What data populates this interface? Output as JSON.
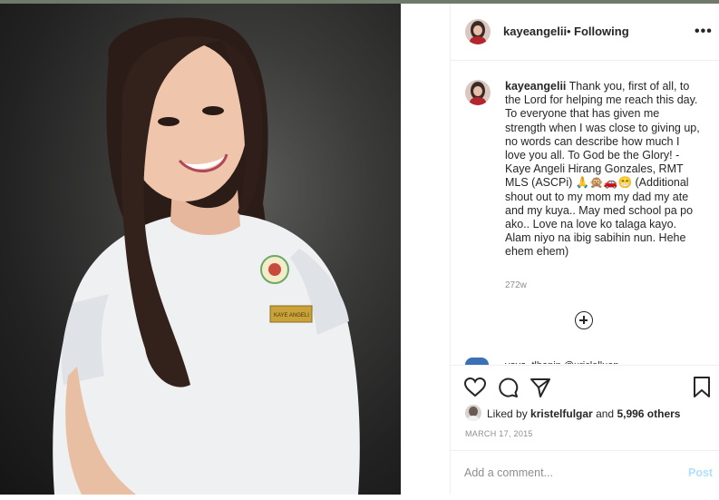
{
  "post": {
    "username": "kayeangelii",
    "separator": "•",
    "follow_status": "Following",
    "more_label": "•••",
    "caption_username": "kayeangelii",
    "caption_text": " Thank you, first of all, to the Lord for helping me reach this day. To everyone that has given me strength when I was close to giving up, no words can describe how much I love you all. To God be the Glory! - Kaye Angeli Hirang Gonzales, RMT MLS (ASCPi) 🙏🙊🚗😁 (Additional shout out to my mom my dad my ate and my kuya.. May med school pa po ako.. Love na love ko talaga kayo. Alam niyo na ibig sabihin nun. Hehe ehem ehem)",
    "caption_time": "272w",
    "next_comment_peek": "yoyo_tlhenin @uriclelluen dano"
  },
  "actions": {
    "liked_by_prefix": "Liked by ",
    "liked_by_user": "kristelfulgar",
    "liked_by_and": " and ",
    "liked_by_others": "5,996 others",
    "date": "MARCH 17, 2015"
  },
  "comment": {
    "placeholder": "Add a comment...",
    "post_label": "Post"
  },
  "colors": {
    "text": "#262626",
    "secondary": "#8e8e8e",
    "post_disabled": "#b2dffc",
    "divider": "#efefef"
  },
  "icons": [
    "heart-icon",
    "comment-icon",
    "share-icon",
    "bookmark-icon",
    "add-comment-icon",
    "more-options-icon"
  ]
}
